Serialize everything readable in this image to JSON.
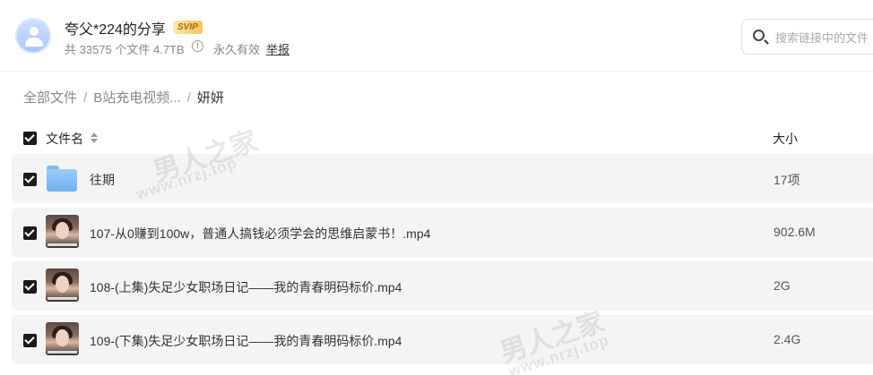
{
  "header": {
    "title": "夸父*224的分享",
    "vip_badge": "SVIP",
    "meta": "共 33575 个文件 4.7TB",
    "validity": "永久有效",
    "report": "举报",
    "info_icon": "info-icon"
  },
  "search": {
    "placeholder": "搜索链接中的文件"
  },
  "breadcrumb": {
    "items": [
      "全部文件",
      "B站充电视频...",
      "妍妍"
    ]
  },
  "table": {
    "columns": {
      "name": "文件名",
      "size": "大小"
    },
    "rows": [
      {
        "name": "往期",
        "size": "17项",
        "type": "folder"
      },
      {
        "name": "107-从0赚到100w，普通人搞钱必须学会的思维启蒙书！.mp4",
        "size": "902.6M",
        "type": "video"
      },
      {
        "name": "108-(上集)失足少女职场日记——我的青春明码标价.mp4",
        "size": "2G",
        "type": "video"
      },
      {
        "name": "109-(下集)失足少女职场日记——我的青春明码标价.mp4",
        "size": "2.4G",
        "type": "video"
      }
    ]
  },
  "watermark": {
    "cn": "男人之家",
    "en": "www.nrzj.top"
  },
  "colors": {
    "row_bg": "#f4f4f5",
    "checkbox": "#1a1a1a",
    "folder": "#7fb9f3",
    "vip_gold": "#f5c35a"
  }
}
